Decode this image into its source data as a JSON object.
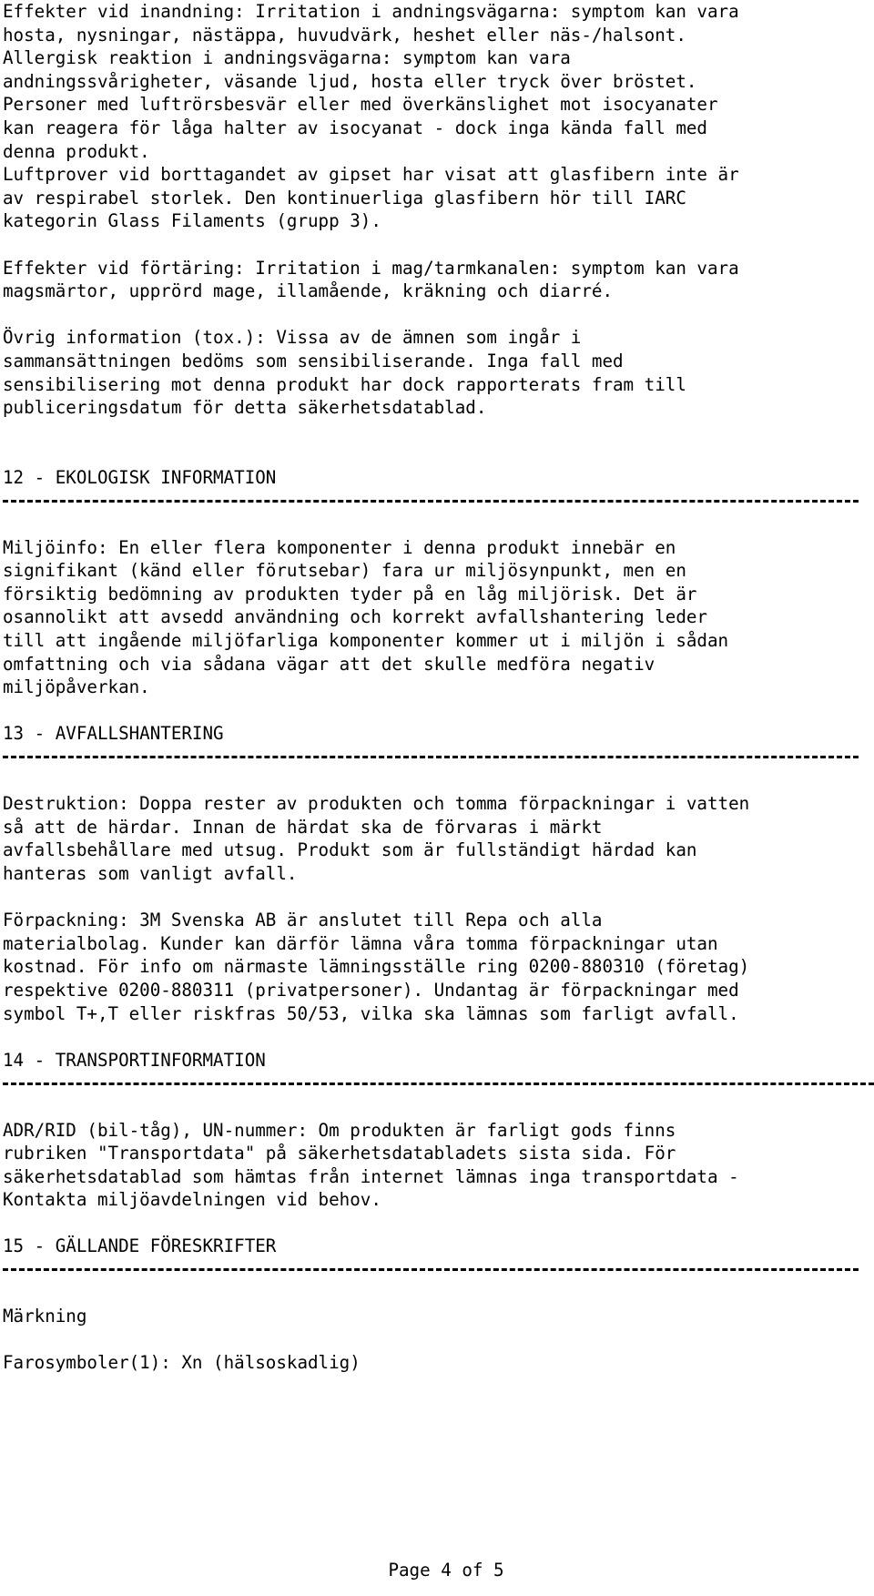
{
  "document": {
    "type": "safety-data-sheet",
    "language": "sv",
    "footer_text": "Page 4 of 5",
    "page_number": 4,
    "page_total": 5,
    "text_color": "#000000",
    "background_color": "#ffffff"
  },
  "blocks": {
    "tox_effects": {
      "lines": [
        "Effekter vid inandning: Irritation i andningsvägarna: symptom kan vara",
        "hosta, nysningar, nästäppa, huvudvärk, heshet eller näs-/halsont.",
        "Allergisk reaktion i andningsvägarna: symptom kan vara",
        "andningssvårigheter, väsande ljud, hosta eller tryck över bröstet.",
        "Personer med luftrörsbesvär eller med överkänslighet mot isocyanater",
        "kan reagera för låga halter av isocyanat - dock inga kända fall med",
        "denna produkt.",
        "Luftprover vid borttagandet av gipset har visat att glasfibern inte är",
        "av respirabel storlek. Den kontinuerliga glasfibern hör till IARC",
        "kategorin Glass Filaments (grupp 3)."
      ]
    },
    "ingestion_effects": {
      "lines": [
        "Effekter vid förtäring: Irritation i mag/tarmkanalen: symptom kan vara",
        "magsmärtor, upprörd mage, illamående, kräkning och diarré."
      ]
    },
    "other_tox_info": {
      "lines": [
        "Övrig information (tox.): Vissa av de ämnen som ingår i",
        "sammansättningen bedöms som sensibiliserande. Inga fall med",
        "sensibilisering mot denna produkt har dock rapporterats fram till",
        "publiceringsdatum för detta säkerhetsdatablad."
      ]
    },
    "section_12": {
      "heading": "12 - EKOLOGISK INFORMATION",
      "lines": [
        "Miljöinfo: En eller flera komponenter i denna produkt innebär en",
        "signifikant (känd eller förutsebar) fara ur miljösynpunkt, men en",
        "försiktig bedömning av produkten tyder på en låg miljörisk. Det är",
        "osannolikt att avsedd användning och korrekt avfallshantering leder",
        "till att ingående miljöfarliga komponenter kommer ut i miljön i sådan",
        "omfattning och via sådana vägar att det skulle medföra negativ",
        "miljöpåverkan."
      ]
    },
    "section_13": {
      "heading": "13 - AVFALLSHANTERING",
      "destruction_lines": [
        "Destruktion: Doppa rester av produkten och tomma förpackningar i vatten",
        "så att de härdar. Innan de härdat ska de förvaras i märkt",
        "avfallsbehållare med utsug. Produkt som är fullständigt härdad kan",
        "hanteras som vanligt avfall."
      ],
      "packaging_lines": [
        "Förpackning: 3M Svenska AB är anslutet till Repa och alla",
        "materialbolag. Kunder kan därför lämna våra tomma förpackningar utan",
        "kostnad. För info om närmaste lämningsställe ring 0200-880310 (företag)",
        "respektive 0200-880311 (privatpersoner). Undantag är förpackningar med",
        "symbol T+,T eller riskfras 50/53, vilka ska lämnas som farligt avfall."
      ]
    },
    "section_14": {
      "heading": "14 - TRANSPORTINFORMATION",
      "lines": [
        "ADR/RID (bil-tåg), UN-nummer: Om produkten är farligt gods finns",
        "rubriken \"Transportdata\" på säkerhetsdatabladets sista sida. För",
        "säkerhetsdatablad som hämtas från internet lämnas inga transportdata -",
        "Kontakta miljöavdelningen vid behov."
      ]
    },
    "section_15": {
      "heading": "15 - GÄLLANDE FÖRESKRIFTER",
      "subheading": "Märkning",
      "hazard_symbols_line": "Farosymboler(1): Xn (hälsoskadlig)"
    }
  }
}
